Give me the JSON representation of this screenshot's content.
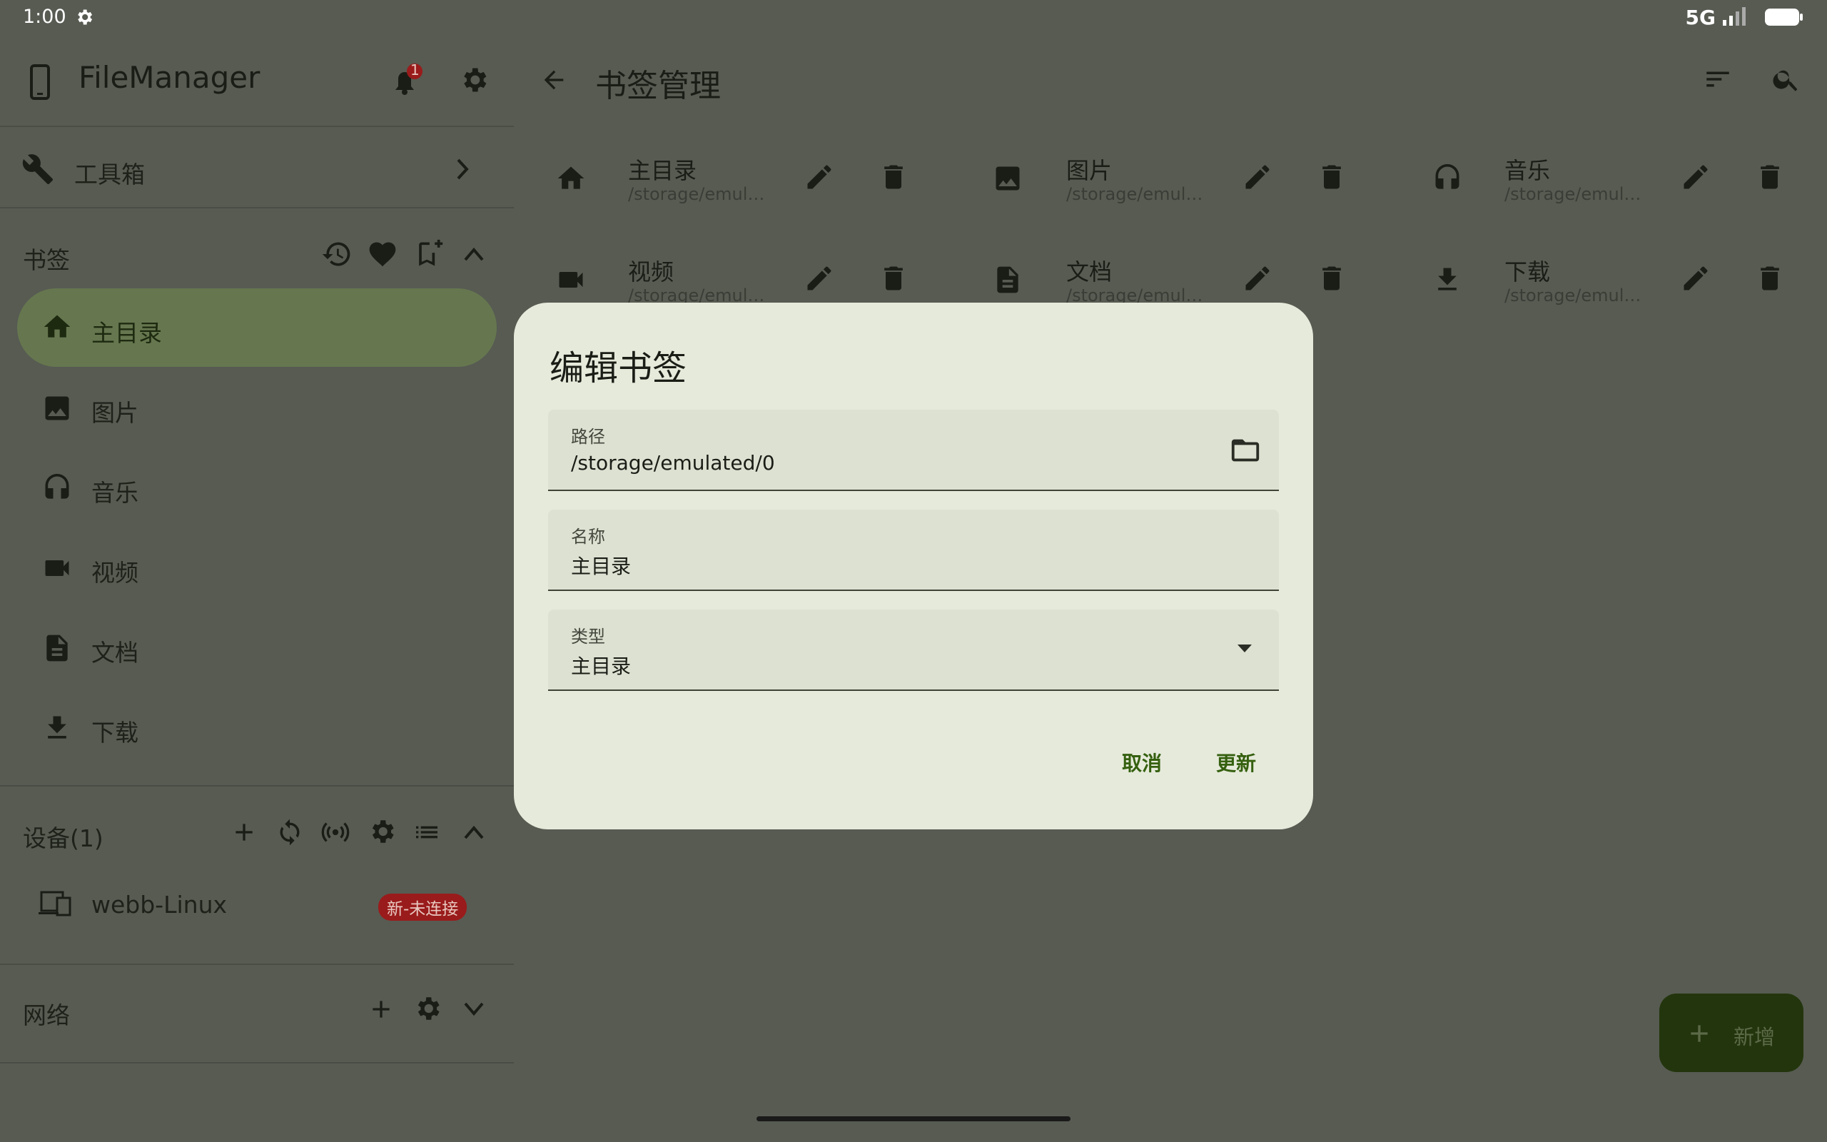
{
  "status_bar": {
    "time": "1:00",
    "network": "5G"
  },
  "sidebar": {
    "app_title": "FileManager",
    "notification_count": "1",
    "toolbox_label": "工具箱",
    "bookmarks_title": "书签",
    "bookmarks": [
      {
        "label": "主目录",
        "icon": "home-icon",
        "active": true
      },
      {
        "label": "图片",
        "icon": "image-icon"
      },
      {
        "label": "音乐",
        "icon": "headphones-icon"
      },
      {
        "label": "视频",
        "icon": "videocam-icon"
      },
      {
        "label": "文档",
        "icon": "document-icon"
      },
      {
        "label": "下载",
        "icon": "download-icon"
      }
    ],
    "devices_title": "设备(1)",
    "device": {
      "name": "webb-Linux",
      "badge": "新-未连接"
    },
    "network_title": "网络"
  },
  "main": {
    "title": "书签管理",
    "bookmark_cards": [
      {
        "name": "主目录",
        "path": "/storage/emul…",
        "icon": "home-icon"
      },
      {
        "name": "图片",
        "path": "/storage/emul…",
        "icon": "image-icon"
      },
      {
        "name": "音乐",
        "path": "/storage/emul…",
        "icon": "headphones-icon"
      },
      {
        "name": "视频",
        "path": "/storage/emul…",
        "icon": "videocam-icon"
      },
      {
        "name": "文档",
        "path": "/storage/emul…",
        "icon": "document-icon"
      },
      {
        "name": "下载",
        "path": "/storage/emul…",
        "icon": "download-icon"
      }
    ],
    "fab_label": "新增"
  },
  "dialog": {
    "title": "编辑书签",
    "path_label": "路径",
    "path_value": "/storage/emulated/0",
    "name_label": "名称",
    "name_value": "主目录",
    "type_label": "类型",
    "type_value": "主目录",
    "cancel_label": "取消",
    "update_label": "更新"
  },
  "colors": {
    "accent": "#35600f",
    "scrim_bg": "#575b52",
    "dialog_bg": "#e6eadb",
    "active_nav": "#66774f",
    "badge": "#9a1b1b"
  }
}
